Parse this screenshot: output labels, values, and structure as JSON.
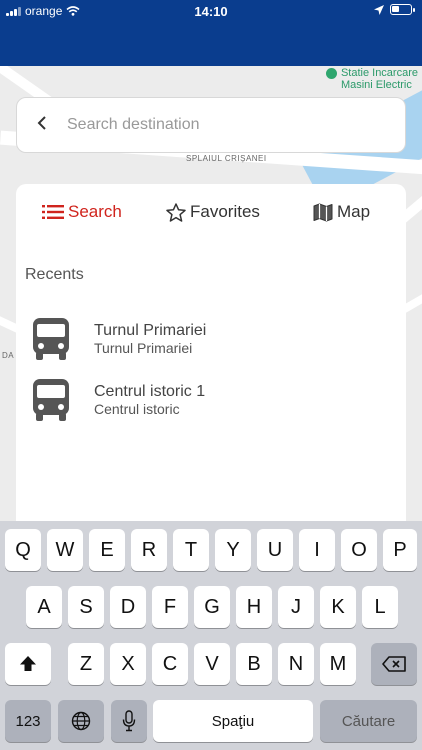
{
  "status_bar": {
    "carrier": "orange",
    "time": "14:10",
    "icons": [
      "signal-bars-icon",
      "wifi-icon",
      "location-arrow-icon",
      "battery-icon"
    ]
  },
  "map": {
    "poi_label_line1": "Statie Incarcare",
    "poi_label_line2": "Masini Electric",
    "street_label": "SPLAIUL CRIȘANEI",
    "edge_label": "DA"
  },
  "search": {
    "placeholder": "Search destination",
    "value": ""
  },
  "tabs": [
    {
      "label": "Search",
      "icon": "list-icon",
      "active": true
    },
    {
      "label": "Favorites",
      "icon": "star-outline-icon",
      "active": false
    },
    {
      "label": "Map",
      "icon": "map-icon",
      "active": false
    }
  ],
  "recents": {
    "title": "Recents",
    "items": [
      {
        "name": "Turnul Primariei",
        "subtitle": "Turnul Primariei",
        "icon": "bus-icon"
      },
      {
        "name": "Centrul istoric 1",
        "subtitle": "Centrul istoric",
        "icon": "bus-icon"
      }
    ]
  },
  "keyboard": {
    "row1": [
      "Q",
      "W",
      "E",
      "R",
      "T",
      "Y",
      "U",
      "I",
      "O",
      "P"
    ],
    "row2": [
      "A",
      "S",
      "D",
      "F",
      "G",
      "H",
      "J",
      "K",
      "L"
    ],
    "row3": [
      "Z",
      "X",
      "C",
      "V",
      "B",
      "N",
      "M"
    ],
    "numbers_key": "123",
    "space_key": "Spaţiu",
    "return_key": "Căutare"
  },
  "colors": {
    "header": "#0a3d8e",
    "accent": "#d0241d",
    "poi": "#2c9a6a"
  }
}
